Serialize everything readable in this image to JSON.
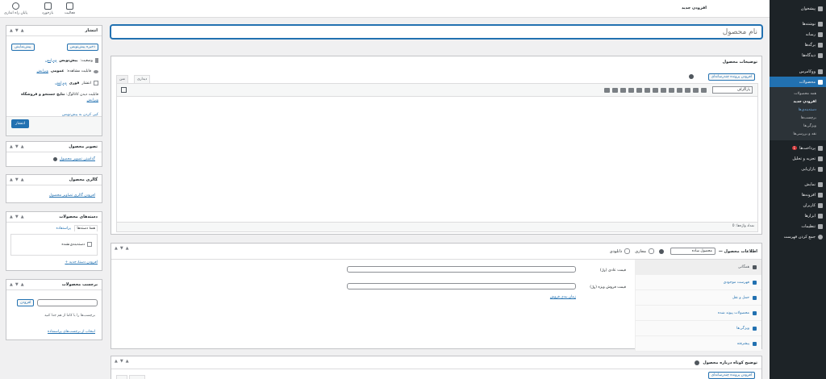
{
  "sidebar": {
    "items": [
      {
        "label": "پیشخوان"
      },
      {
        "label": "نوشته‌ها"
      },
      {
        "label": "رسانه"
      },
      {
        "label": "برگه‌ها"
      },
      {
        "label": "دیدگاه‌ها"
      },
      {
        "label": "ووکامرس"
      },
      {
        "label": "محصولات"
      }
    ],
    "submenu": [
      "همه محصولات",
      "افزودن جدید",
      "دسته‌بندی‌ها",
      "برچسب‌ها",
      "ویژگی‌ها",
      "نقد و بررسی‌ها"
    ],
    "items2": [
      {
        "label": "پرداخت‌ها",
        "badge": "1"
      },
      {
        "label": "تجزیه و تحلیل"
      },
      {
        "label": "بازاریابی"
      },
      {
        "label": "نمایش"
      },
      {
        "label": "افزونه‌ها"
      },
      {
        "label": "کاربران"
      },
      {
        "label": "ابزارها"
      },
      {
        "label": "تنظیمات"
      },
      {
        "label": "جمع کردن فهرست"
      }
    ]
  },
  "topbar": {
    "page_title": "افزودن جدید",
    "activity": "فعالیت",
    "feedback": "بازخورد",
    "store_setup": "پایان راه اندازی"
  },
  "title_input": {
    "placeholder": "نام محصول"
  },
  "desc_box": {
    "title": "توضیحات محصول",
    "add_media": "افزودن پرونده چندرسانه‌ای",
    "tab_visual": "دیداری",
    "tab_text": "متن",
    "format": "پاراگراف",
    "word_count": "تعداد واژه‌ها: 0"
  },
  "product_data": {
    "title": "اطلاعات محصول —",
    "type": "محصول ساده",
    "virtual": "مجازی",
    "downloadable": "دانلودی",
    "nav": [
      "همگانی",
      "فهرست موجودی",
      "حمل و نقل",
      "محصولات پیوند شده",
      "ویژگی‌ها",
      "پیشرفته"
    ],
    "regular_price": "قیمت عادی (﷼)",
    "sale_price": "قیمت فروش ویژه (﷼)",
    "schedule": "زمان بندی فروش"
  },
  "short_desc": {
    "title": "توضیح کوتاه درباره محصول",
    "add_media": "افزودن پرونده چندرسانه‌ای"
  },
  "publish": {
    "title": "انتشار",
    "save_draft": "ذخیره پیش‌نویس",
    "preview": "پیش‌نمایش",
    "status_label": "وضعیت:",
    "status_value": "پیش‌نویس",
    "edit": "ویرایش",
    "visibility_label": "قابلیت مشاهده:",
    "visibility_value": "عمومی",
    "publish_label": "انتشار",
    "publish_value": "فوری",
    "catalog_label": "قابلیت دیدن کاتالوگ:",
    "catalog_value": "نتایج جستجو و فروشگاه",
    "copy_draft": "کپی کردن به پیش‌نویس",
    "publish_btn": "انتشار"
  },
  "product_image": {
    "title": "تصویر محصول",
    "link": "گذاشتن تصویر محصول"
  },
  "gallery": {
    "title": "گالری محصول",
    "link": "افزودن گالری تصاویر محصول"
  },
  "categories": {
    "title": "دسته‌های محصولات",
    "tab_all": "همهٔ دسته‌ها",
    "tab_popular": "پراستفاده",
    "uncategorized": "دسته‌بندی‌نشده",
    "add_new": "+ افزودن دستهٔ جدید"
  },
  "tags": {
    "title": "برچسب محصولات",
    "add_btn": "افزودن",
    "hint": "برچسب‌ها را با کاما از هم جدا کنید",
    "choose": "انتخاب از برچسب‌های پراستفاده"
  }
}
